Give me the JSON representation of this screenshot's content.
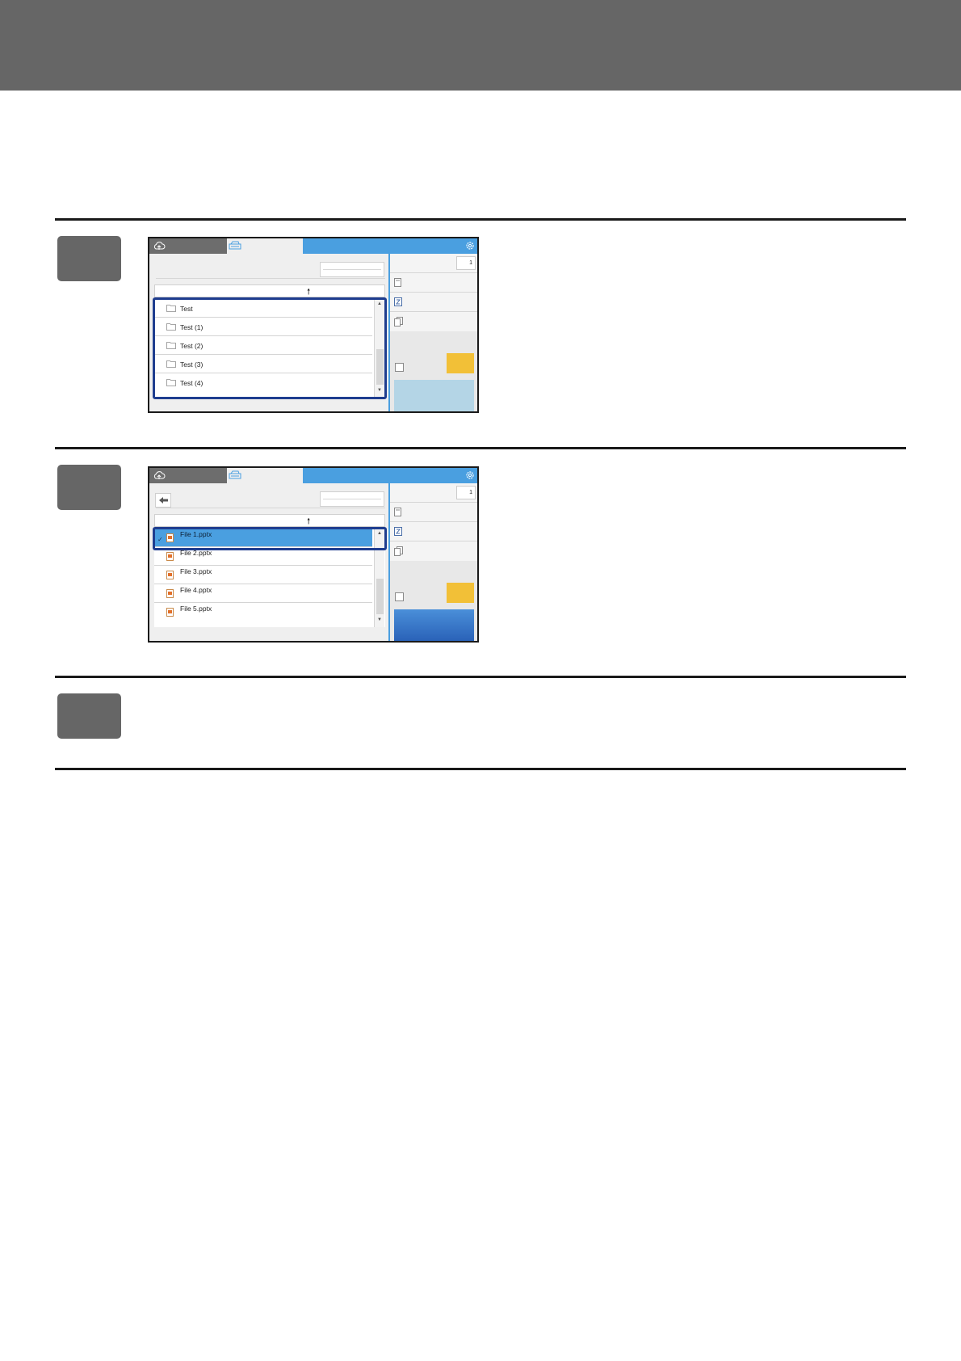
{
  "steps": [
    {
      "copies": "1",
      "items": [
        {
          "label": "Test"
        },
        {
          "label": "Test (1)"
        },
        {
          "label": "Test (2)"
        },
        {
          "label": "Test (3)"
        },
        {
          "label": "Test (4)"
        }
      ]
    },
    {
      "copies": "1",
      "items": [
        {
          "label": "File 1.pptx"
        },
        {
          "label": "File 2.pptx"
        },
        {
          "label": "File 3.pptx"
        },
        {
          "label": "File 4.pptx"
        },
        {
          "label": "File 5.pptx"
        }
      ]
    }
  ],
  "icons": {
    "cloud": "cloud-upload-icon",
    "printer": "scanner-printer-icon",
    "settings": "gear-icon",
    "folder": "folder-icon",
    "file": "pptx-file-icon",
    "up": "up-arrow-icon",
    "back": "back-arrow-icon",
    "check": "checkmark-icon"
  },
  "colors": {
    "header": "#666666",
    "accent": "#4a9fe0",
    "highlight": "#1f3d8f",
    "start_disabled": "#b4d5e6",
    "start_enabled": "#2a62b8",
    "yellow": "#f2c037"
  }
}
